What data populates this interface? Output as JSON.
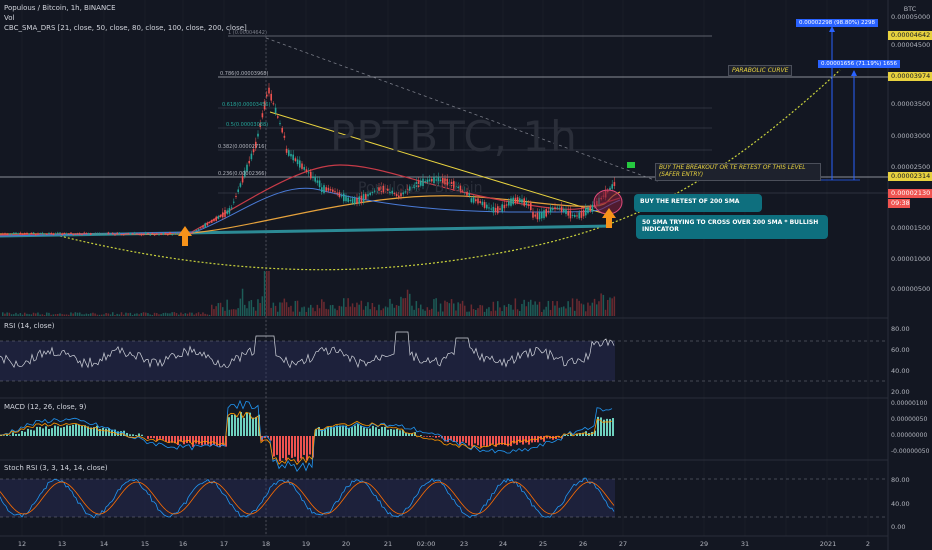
{
  "header": {
    "symbol_line": "Populous / Bitcoin, 1h, BINANCE",
    "vol_label": "Vol",
    "indicator_line": "CBC_SMA_DRS [21, close, 50, close, 80, close, 100, close, 200, close]"
  },
  "watermark": {
    "symbol": "PPTBTC, 1h",
    "name": "Populous / Bitcoin"
  },
  "price_axis": {
    "currency": "BTC",
    "ticks": [
      "0.00005000",
      "0.00004500",
      "0.00003500",
      "0.00003000",
      "0.00002500",
      "0.00001500",
      "0.00001000",
      "0.00000500"
    ],
    "tag_high": "0.00004642",
    "tag_mid": "0.00003974",
    "tag_level": "0.00002314",
    "tag_last": "0.00002130",
    "tag_countdown": "09:38"
  },
  "fib_labels": [
    "1 (0.00004642)",
    "0.786(0.00003968)",
    "0.618(0.00003456)",
    "0.5(0.00003088)",
    "0.382(0.00002716)",
    "0.236(0.00002366)"
  ],
  "annotations": {
    "measure_top": "0.00002298 (98.80%) 2298",
    "measure_mid": "0.00001656 (71.19%) 1656",
    "parabolic": "PARABOLIC CURVE",
    "breakout": "BUY THE BREAKOUT OR TE RETEST OF THIS LEVEL (SAFER ENTRY)",
    "retest": "BUY THE RETEST OF 200 SMA",
    "cross": "50 SMA TRYING TO CROSS OVER 200 SMA * BULLISH INDICATOR"
  },
  "panes": {
    "rsi": {
      "title": "RSI (14, close)",
      "ticks": [
        "80.00",
        "60.00",
        "40.00",
        "20.00"
      ]
    },
    "macd": {
      "title": "MACD (12, 26, close, 9)",
      "ticks": [
        "0.00000100",
        "0.00000050",
        "0.00000000",
        "-0.00000050"
      ]
    },
    "stoch": {
      "title": "Stoch RSI (3, 3, 14, 14, close)",
      "ticks": [
        "80.00",
        "40.00",
        "0.00"
      ]
    }
  },
  "time_axis": [
    "12",
    "13",
    "14",
    "15",
    "16",
    "17",
    "18",
    "19",
    "20",
    "21",
    "02:00",
    "23",
    "24",
    "25",
    "26",
    "27",
    "29",
    "31",
    "2021",
    "2"
  ],
  "colors": {
    "bg": "#131722",
    "teal": "#0e6f7e",
    "blue": "#2962ff",
    "yellow": "#e8d23f",
    "red": "#ef5350"
  }
}
